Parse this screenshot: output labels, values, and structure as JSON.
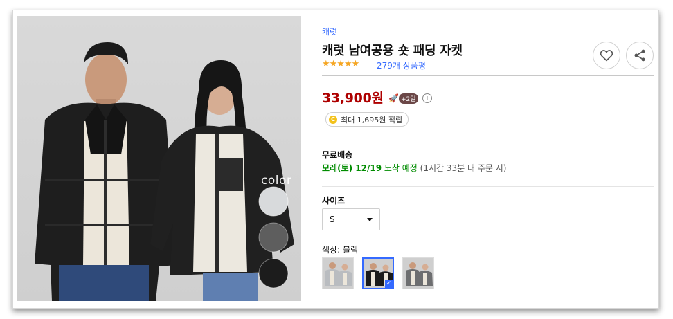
{
  "product": {
    "brand": "캐럿",
    "title": "캐럿 남여공용 숏 패딩 자켓",
    "rating_stars": "★★★★★",
    "review_count": "279개 상품평",
    "price": "33,900원",
    "delivery_badge": "+2일",
    "reward_coin": "C",
    "reward": "최대 1,695원 적립"
  },
  "shipping": {
    "label": "무료배송",
    "date_main": "모레(토) 12/19",
    "date_suffix": " 도착 예정",
    "note": " (1시간 33분 내 주문 시)"
  },
  "options": {
    "size_label": "사이즈",
    "size_selected": "S",
    "color_label": "색상: 블랙"
  },
  "photo": {
    "overlay_text": "color"
  },
  "thumbnails": [
    {
      "jacket_color": "#b9bcc0",
      "selected": false
    },
    {
      "jacket_color": "#1a1a1a",
      "selected": true
    },
    {
      "jacket_color": "#6d6e70",
      "selected": false
    }
  ],
  "icons": {
    "wishlist": "heart-icon",
    "share": "share-icon",
    "rocket": "rocket-icon",
    "info": "info-icon"
  },
  "colors": {
    "brand_link": "#346aff",
    "price": "#ae0000",
    "ship_green": "#008c00",
    "star": "#f5a623"
  }
}
